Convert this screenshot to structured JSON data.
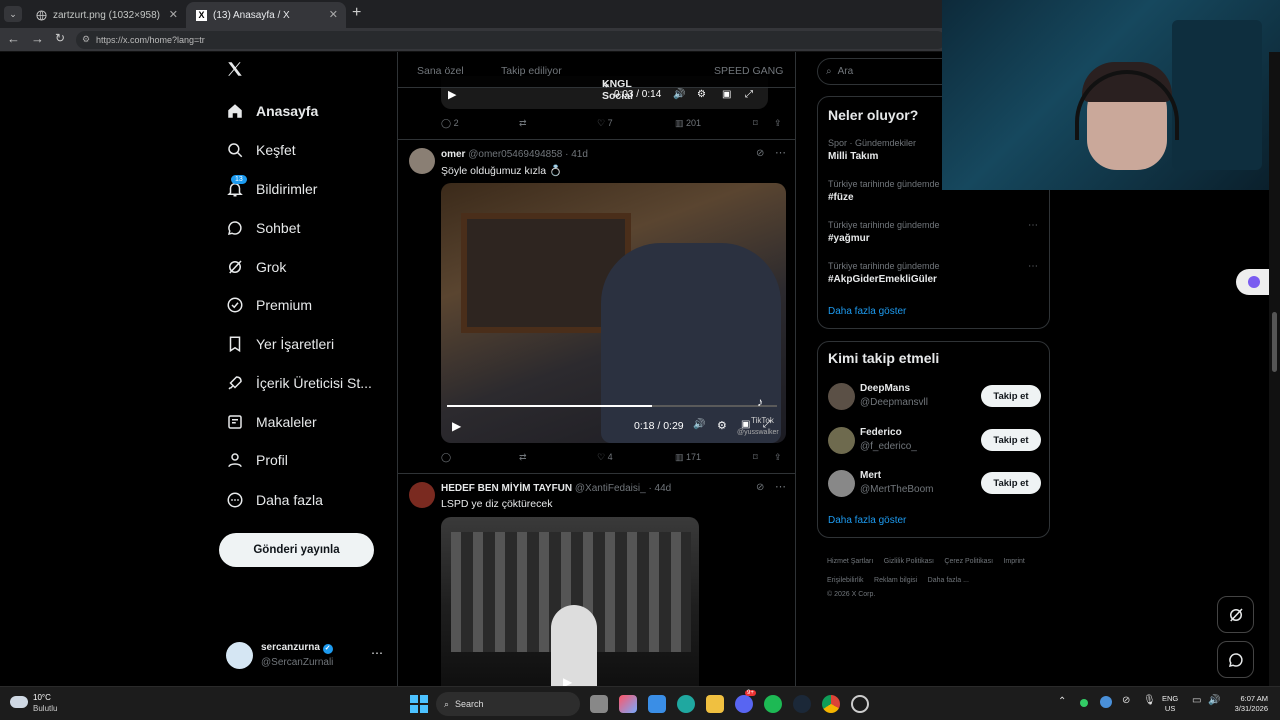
{
  "browser": {
    "tabs": [
      {
        "title": "zartzurt.png (1032×958)"
      },
      {
        "title": "(13) Anasayfa / X"
      }
    ],
    "url": "https://x.com/home?lang=tr"
  },
  "sidebar": {
    "items": [
      {
        "label": "Anasayfa",
        "icon": "home-icon"
      },
      {
        "label": "Keşfet",
        "icon": "search-icon"
      },
      {
        "label": "Bildirimler",
        "icon": "bell-icon",
        "badge": "13"
      },
      {
        "label": "Sohbet",
        "icon": "chat-icon"
      },
      {
        "label": "Grok",
        "icon": "grok-icon"
      },
      {
        "label": "Premium",
        "icon": "verified-icon"
      },
      {
        "label": "Yer İşaretleri",
        "icon": "bookmark-icon"
      },
      {
        "label": "İçerik Üreticisi St...",
        "icon": "rocket-icon"
      },
      {
        "label": "Makaleler",
        "icon": "article-icon"
      },
      {
        "label": "Profil",
        "icon": "user-icon"
      },
      {
        "label": "Daha fazla",
        "icon": "more-circle-icon"
      }
    ],
    "post_button": "Gönderi yayınla",
    "account": {
      "name": "sercanzurna",
      "handle": "@SercanZurnali"
    }
  },
  "feed": {
    "tabs": [
      "Sana özel",
      "Takip ediliyor",
      "KNGL Social",
      "SPEED GANG"
    ],
    "active_tab": "KNGL Social",
    "post0": {
      "video_time": "0:03 / 0:14",
      "replies": "2",
      "likes": "7",
      "views": "201"
    },
    "post1": {
      "name": "omer",
      "handle": "@omer05469494858",
      "time": "41d",
      "text": "Şöyle olduğumuz kızla 💍",
      "video_time": "0:18 / 0:29",
      "watermark": "TikTok",
      "watermark_user": "@yusswalker",
      "replies": "",
      "likes": "4",
      "views": "171",
      "progress": 0.62
    },
    "post2": {
      "name": "HEDEF BEN MİYİM TAYFUN",
      "handle": "@XantiFedaisi_",
      "time": "44d",
      "text": "LSPD ye diz çöktürecek"
    }
  },
  "right": {
    "search_placeholder": "Ara",
    "trends_title": "Neler oluyor?",
    "trends": [
      {
        "context": "Spor · Gündemdekiler",
        "title": "Milli Takım"
      },
      {
        "context": "Türkiye tarihinde gündemde",
        "title": "#füze"
      },
      {
        "context": "Türkiye tarihinde gündemde",
        "title": "#yağmur"
      },
      {
        "context": "Türkiye tarihinde gündemde",
        "title": "#AkpGiderEmekliGüler"
      }
    ],
    "trends_more": "Daha fazla göster",
    "wtf_title": "Kimi takip etmeli",
    "follow": [
      {
        "name": "DeepMans",
        "handle": "@Deepmansvll"
      },
      {
        "name": "Federico",
        "handle": "@f_ederico_"
      },
      {
        "name": "Mert",
        "handle": "@MertTheBoom"
      }
    ],
    "follow_btn": "Takip et",
    "wtf_more": "Daha fazla göster",
    "footer_links": [
      "Hizmet Şartları",
      "Gizlilik Politikası",
      "Çerez Politikası",
      "Imprint",
      "Erişilebilirlik",
      "Reklam bilgisi",
      "Daha fazla ..."
    ],
    "copyright": "© 2026 X Corp."
  },
  "taskbar": {
    "weather_temp": "10°C",
    "weather_desc": "Bulutlu",
    "search": "Search",
    "lang1": "ENG",
    "lang2": "US",
    "time": "6:07 AM",
    "date": "3/31/2026",
    "discord_badge": "9+"
  },
  "colors": {
    "accent": "#1d9bf0",
    "bg": "#000000",
    "border": "#2f3336",
    "muted": "#71767b"
  }
}
